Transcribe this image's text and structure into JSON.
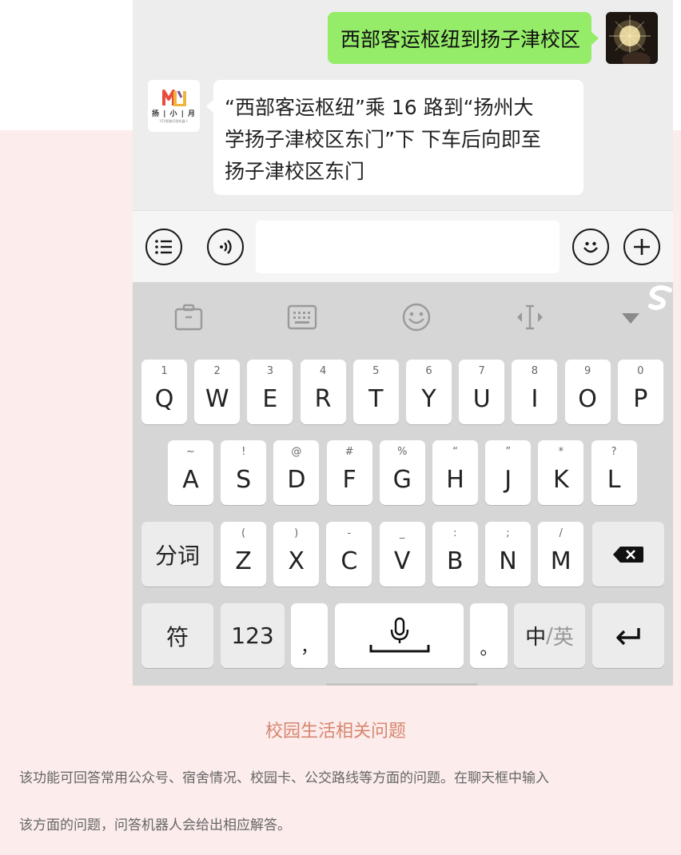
{
  "chat": {
    "user_message": "西部客运枢纽到扬子津校区",
    "bot_avatar": {
      "logo_caption": "扬 | 小 | 月",
      "logo_sub": "YZU智能问答机器人"
    },
    "bot_message_lines": [
      "“西部客运枢纽”乘 16 路到“扬州大",
      "学扬子津校区东门”下 下车后向即至",
      "扬子津校区东门"
    ]
  },
  "input_bar": {
    "left_icons": [
      "list-icon",
      "voice-icon"
    ],
    "right_icons": [
      "emoji-icon",
      "plus-icon"
    ],
    "message_value": ""
  },
  "keyboard": {
    "toolbar_icons": [
      "clipboard-icon",
      "keyboard-icon",
      "emoji-icon",
      "cursor-icon",
      "collapse-icon"
    ],
    "row1": [
      {
        "hint": "1",
        "key": "Q"
      },
      {
        "hint": "2",
        "key": "W"
      },
      {
        "hint": "3",
        "key": "E"
      },
      {
        "hint": "4",
        "key": "R"
      },
      {
        "hint": "5",
        "key": "T"
      },
      {
        "hint": "6",
        "key": "Y"
      },
      {
        "hint": "7",
        "key": "U"
      },
      {
        "hint": "8",
        "key": "I"
      },
      {
        "hint": "9",
        "key": "O"
      },
      {
        "hint": "0",
        "key": "P"
      }
    ],
    "row2": [
      {
        "hint": "~",
        "key": "A"
      },
      {
        "hint": "!",
        "key": "S"
      },
      {
        "hint": "@",
        "key": "D"
      },
      {
        "hint": "#",
        "key": "F"
      },
      {
        "hint": "%",
        "key": "G"
      },
      {
        "hint": "“",
        "key": "H"
      },
      {
        "hint": "”",
        "key": "J"
      },
      {
        "hint": "*",
        "key": "K"
      },
      {
        "hint": "?",
        "key": "L"
      }
    ],
    "row3": [
      {
        "hint": "(",
        "key": "Z"
      },
      {
        "hint": ")",
        "key": "X"
      },
      {
        "hint": "-",
        "key": "C"
      },
      {
        "hint": "_",
        "key": "V"
      },
      {
        "hint": ":",
        "key": "B"
      },
      {
        "hint": ";",
        "key": "N"
      },
      {
        "hint": "/",
        "key": "M"
      }
    ],
    "segment_label": "分词",
    "symbol_label": "符",
    "numbers_label": "123",
    "comma_label": "，",
    "period_label": "。",
    "lang_label_zh": "中",
    "lang_label_sep": "/",
    "lang_label_en": "英"
  },
  "caption": "校园生活相关问题",
  "description_lines": [
    "该功能可回答常用公众号、宿舍情况、校园卡、公交路线等方面的问题。在聊天框中输入",
    "该方面的问题，问答机器人会给出相应解答。"
  ],
  "colors": {
    "page_bg_pink": "#fcecec",
    "user_bubble": "#95ec69",
    "chat_bg": "#ededed",
    "keyboard_bg": "#d6d6d6",
    "caption": "#d6866f"
  }
}
